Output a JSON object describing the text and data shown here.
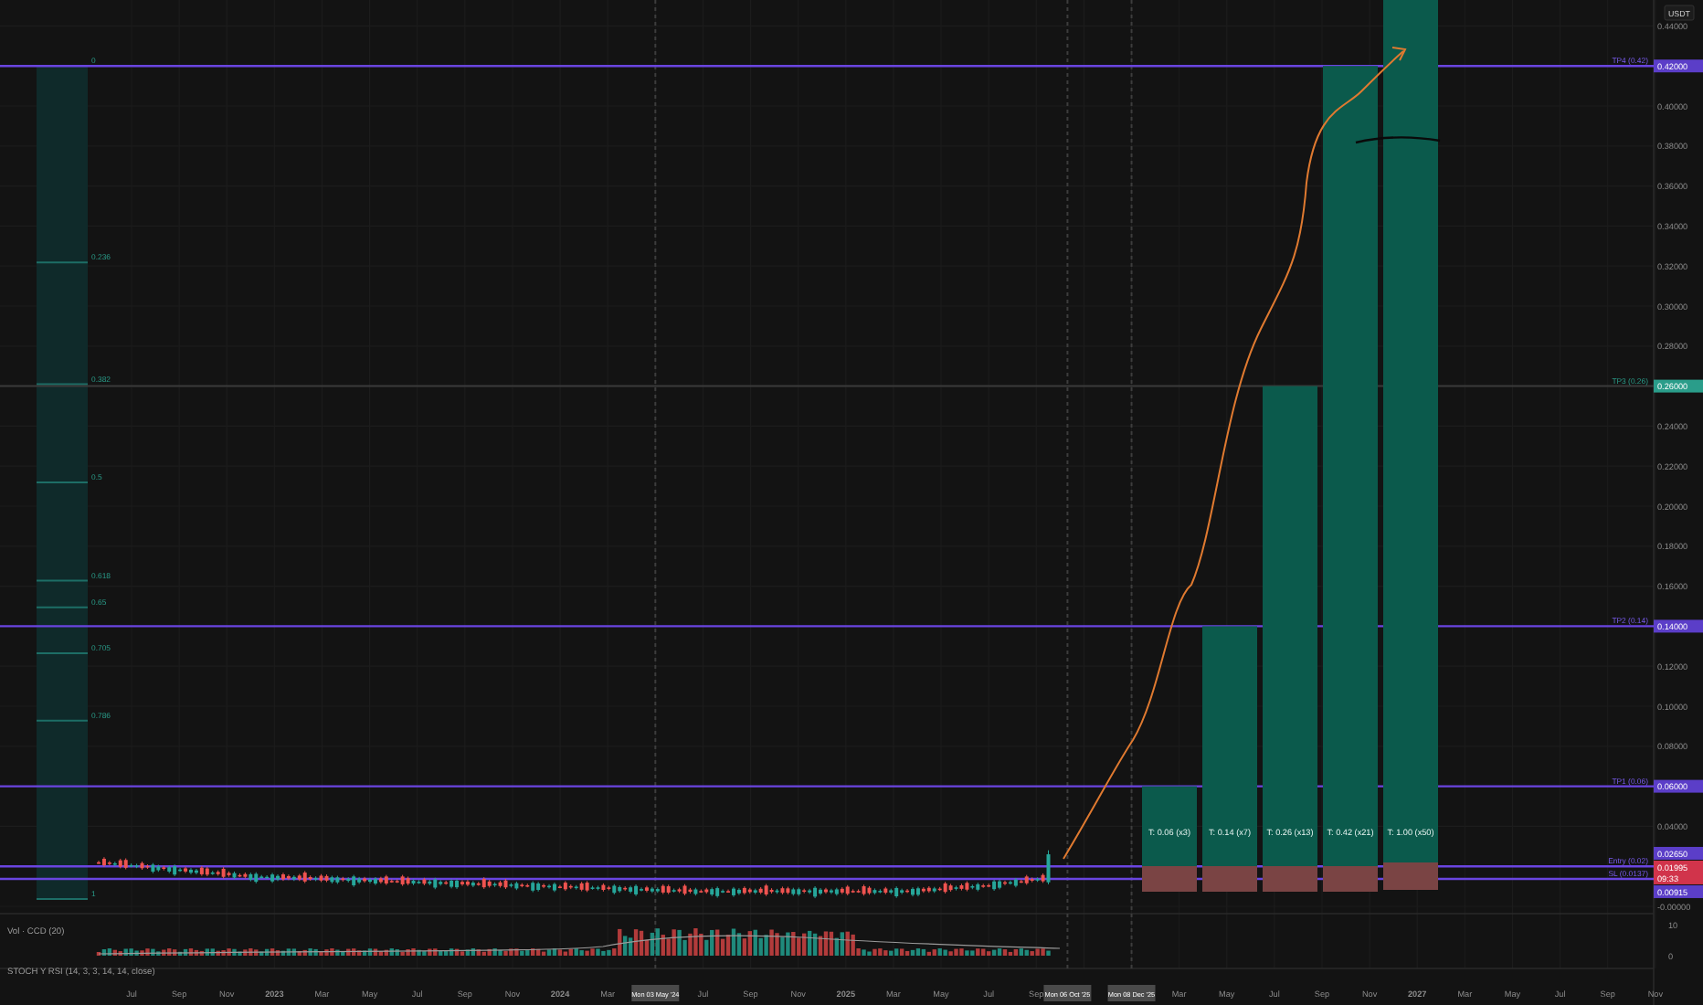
{
  "currency": "USDT",
  "price_axis": [
    "0.44000",
    "0.40000",
    "0.38000",
    "0.36000",
    "0.34000",
    "0.32000",
    "0.30000",
    "0.28000",
    "0.24000",
    "0.22000",
    "0.20000",
    "0.18000",
    "0.16000",
    "0.12000",
    "0.10000",
    "0.08000",
    "0.04000",
    "-0.00000"
  ],
  "levels": [
    {
      "label": "TP4 (0.42)",
      "kind": "target"
    },
    {
      "label": "TP3 (0.26)",
      "kind": "mid"
    },
    {
      "label": "TP2 (0.14)",
      "kind": "target"
    },
    {
      "label": "TP1 (0.06)",
      "kind": "target"
    },
    {
      "label": "Entry (0.02)",
      "kind": "target"
    },
    {
      "label": "SL (0.0137)",
      "kind": "target"
    }
  ],
  "price_tags": [
    {
      "text": "0.42000",
      "color": "#5b3ec8"
    },
    {
      "text": "0.26000",
      "color": "#2a9d8a"
    },
    {
      "text": "0.14000",
      "color": "#5b3ec8"
    },
    {
      "text": "0.06000",
      "color": "#5b3ec8"
    },
    {
      "text": "0.02650",
      "color": "#5b3ec8"
    },
    {
      "text": "0.01995",
      "sub": "09:33",
      "color": "#d1344b"
    },
    {
      "text": "0.00915",
      "color": "#5b3ec8"
    }
  ],
  "fib_levels": [
    "0",
    "0.236",
    "0.382",
    "0.5",
    "0.618",
    "0.65",
    "0.705",
    "0.786",
    "1"
  ],
  "targets": [
    {
      "label": "T: 0.06 (x3)"
    },
    {
      "label": "T: 0.14 (x7)"
    },
    {
      "label": "T: 0.26 (x13)"
    },
    {
      "label": "T: 0.42 (x21)"
    },
    {
      "label": "T: 1.00 (x50)"
    }
  ],
  "volume_axis": [
    "10",
    "0"
  ],
  "indicators": [
    "Vol · CCD (20)",
    "STOCH Y RSI (14, 3, 3, 14, 14, close)"
  ],
  "time_axis": [
    {
      "text": "Jul",
      "kind": "tick"
    },
    {
      "text": "Sep",
      "kind": "tick"
    },
    {
      "text": "Nov",
      "kind": "tick"
    },
    {
      "text": "2023",
      "kind": "year"
    },
    {
      "text": "Mar",
      "kind": "tick"
    },
    {
      "text": "May",
      "kind": "tick"
    },
    {
      "text": "Jul",
      "kind": "tick"
    },
    {
      "text": "Sep",
      "kind": "tick"
    },
    {
      "text": "Nov",
      "kind": "tick"
    },
    {
      "text": "2024",
      "kind": "year"
    },
    {
      "text": "Mar",
      "kind": "tick"
    },
    {
      "text": "Mon 03 May '24",
      "kind": "marker"
    },
    {
      "text": "Jul",
      "kind": "tick"
    },
    {
      "text": "Sep",
      "kind": "tick"
    },
    {
      "text": "Nov",
      "kind": "tick"
    },
    {
      "text": "2025",
      "kind": "year"
    },
    {
      "text": "Mar",
      "kind": "tick"
    },
    {
      "text": "May",
      "kind": "tick"
    },
    {
      "text": "Jul",
      "kind": "tick"
    },
    {
      "text": "Sep",
      "kind": "tick"
    },
    {
      "text": "Mon 06 Oct '25",
      "kind": "marker"
    },
    {
      "text": "Mon 08 Dec '25",
      "kind": "marker"
    },
    {
      "text": "Mar",
      "kind": "tick"
    },
    {
      "text": "May",
      "kind": "tick"
    },
    {
      "text": "Jul",
      "kind": "tick"
    },
    {
      "text": "Sep",
      "kind": "tick"
    },
    {
      "text": "Nov",
      "kind": "tick"
    },
    {
      "text": "2027",
      "kind": "year"
    },
    {
      "text": "Mar",
      "kind": "tick"
    },
    {
      "text": "May",
      "kind": "tick"
    },
    {
      "text": "Jul",
      "kind": "tick"
    },
    {
      "text": "Sep",
      "kind": "tick"
    },
    {
      "text": "Nov",
      "kind": "tick"
    }
  ]
}
